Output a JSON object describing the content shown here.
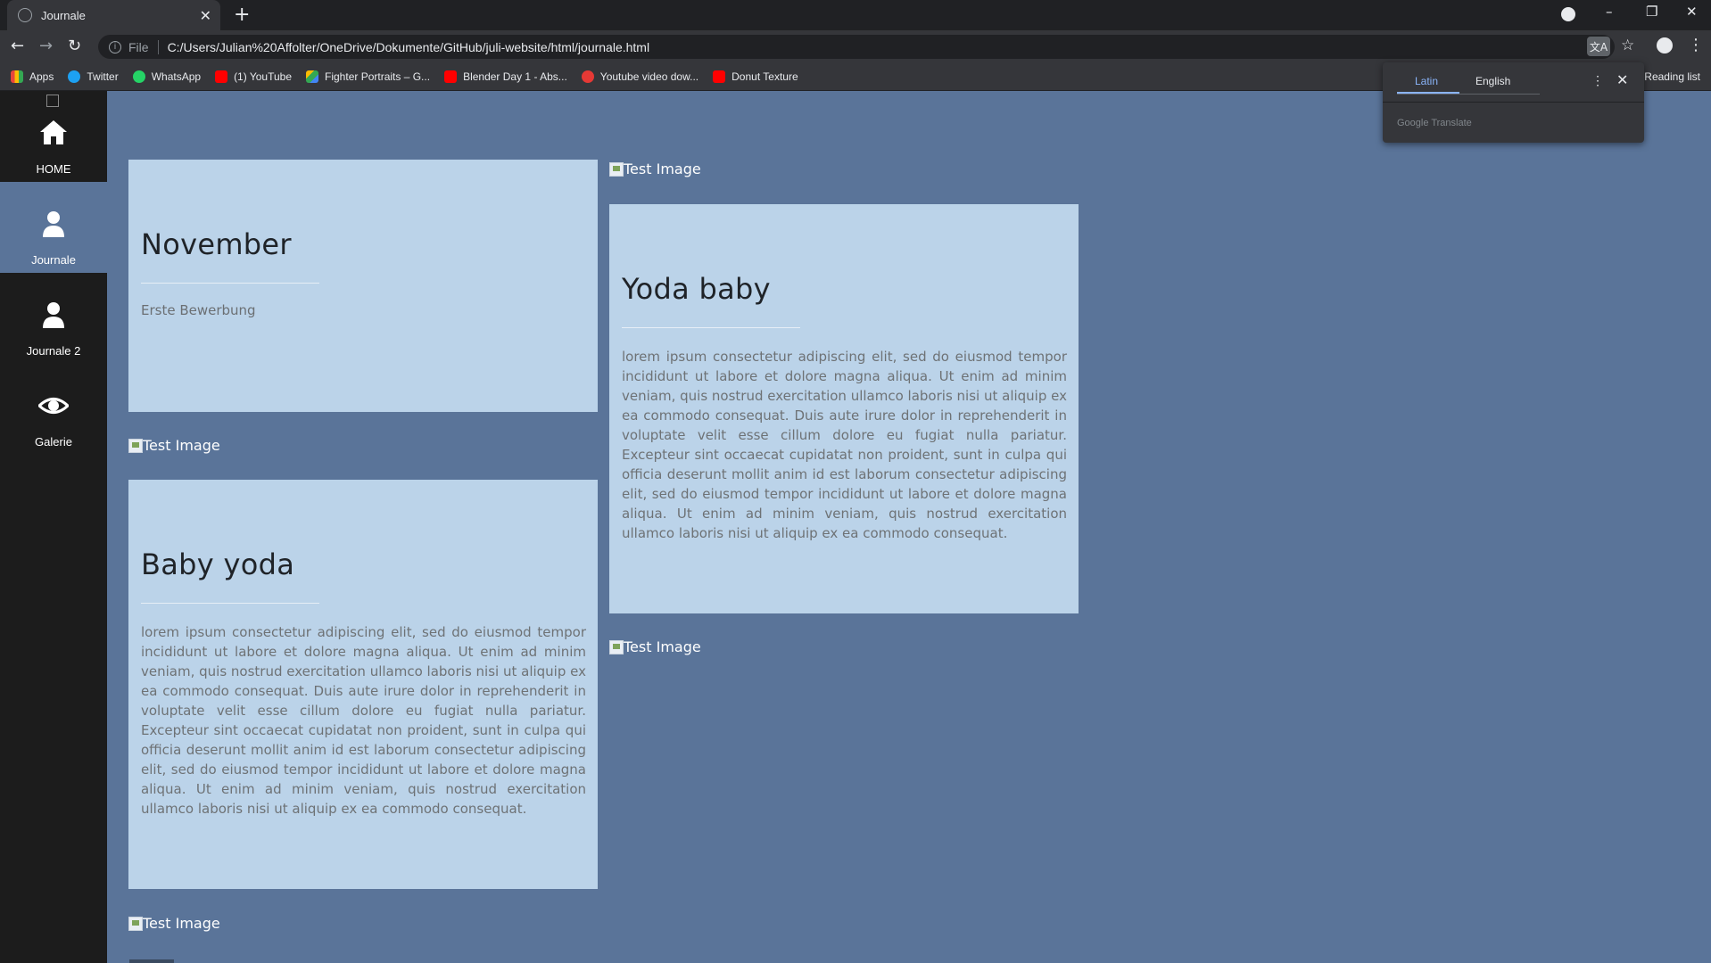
{
  "browser": {
    "tab_title": "Journale",
    "new_tab": "+",
    "url_scheme": "File",
    "url": "C:/Users/Julian%20Affolter/OneDrive/Dokumente/GitHub/juli-website/html/journale.html",
    "bookmarks": [
      {
        "label": "Apps",
        "color": "#e8453c"
      },
      {
        "label": "Twitter",
        "color": "#1da1f2"
      },
      {
        "label": "WhatsApp",
        "color": "#25d366"
      },
      {
        "label": "(1) YouTube",
        "color": "#ff0000"
      },
      {
        "label": "Fighter Portraits – G...",
        "color": "#fbbc04"
      },
      {
        "label": "Blender Day 1 - Abs...",
        "color": "#ff0000"
      },
      {
        "label": "Youtube video dow...",
        "color": "#e53935"
      },
      {
        "label": "Donut Texture",
        "color": "#ff0000"
      }
    ],
    "reading_list": "Reading list"
  },
  "translate": {
    "source_lang": "Latin",
    "target_lang": "English",
    "brand": "Google Translate"
  },
  "sidebar": {
    "items": [
      {
        "label": "HOME",
        "icon": "home-icon"
      },
      {
        "label": "Journale",
        "icon": "user-icon"
      },
      {
        "label": "Journale 2",
        "icon": "user-icon"
      },
      {
        "label": "Galerie",
        "icon": "eye-icon"
      }
    ]
  },
  "cards": {
    "november": {
      "title": "November",
      "subtitle": "Erste Bewerbung"
    },
    "yoda_baby": {
      "title": "Yoda baby",
      "body": "lorem ipsum consectetur adipiscing elit, sed do eiusmod tempor incididunt ut labore et dolore magna aliqua. Ut enim ad minim veniam, quis nostrud exercitation ullamco laboris nisi ut aliquip ex ea commodo consequat. Duis aute irure dolor in reprehenderit in voluptate velit esse cillum dolore eu fugiat nulla pariatur. Excepteur sint occaecat cupidatat non proident, sunt in culpa qui officia deserunt mollit anim id est laborum consectetur adipiscing elit, sed do eiusmod tempor incididunt ut labore et dolore magna aliqua. Ut enim ad minim veniam, quis nostrud exercitation ullamco laboris nisi ut aliquip ex ea commodo consequat."
    },
    "baby_yoda": {
      "title": "Baby yoda",
      "body": "lorem ipsum consectetur adipiscing elit, sed do eiusmod tempor incididunt ut labore et dolore magna aliqua. Ut enim ad minim veniam, quis nostrud exercitation ullamco laboris nisi ut aliquip ex ea commodo consequat. Duis aute irure dolor in reprehenderit in voluptate velit esse cillum dolore eu fugiat nulla pariatur. Excepteur sint occaecat cupidatat non proident, sunt in culpa qui officia deserunt mollit anim id est laborum consectetur adipiscing elit, sed do eiusmod tempor incididunt ut labore et dolore magna aliqua. Ut enim ad minim veniam, quis nostrud exercitation ullamco laboris nisi ut aliquip ex ea commodo consequat."
    }
  },
  "images": {
    "alt_text": "Test Image"
  },
  "colors": {
    "page_bg": "#5a7499",
    "card_bg": "#bbd3e9",
    "sidebar_bg": "#1c1c1c",
    "sidebar_active": "#5a7499"
  }
}
